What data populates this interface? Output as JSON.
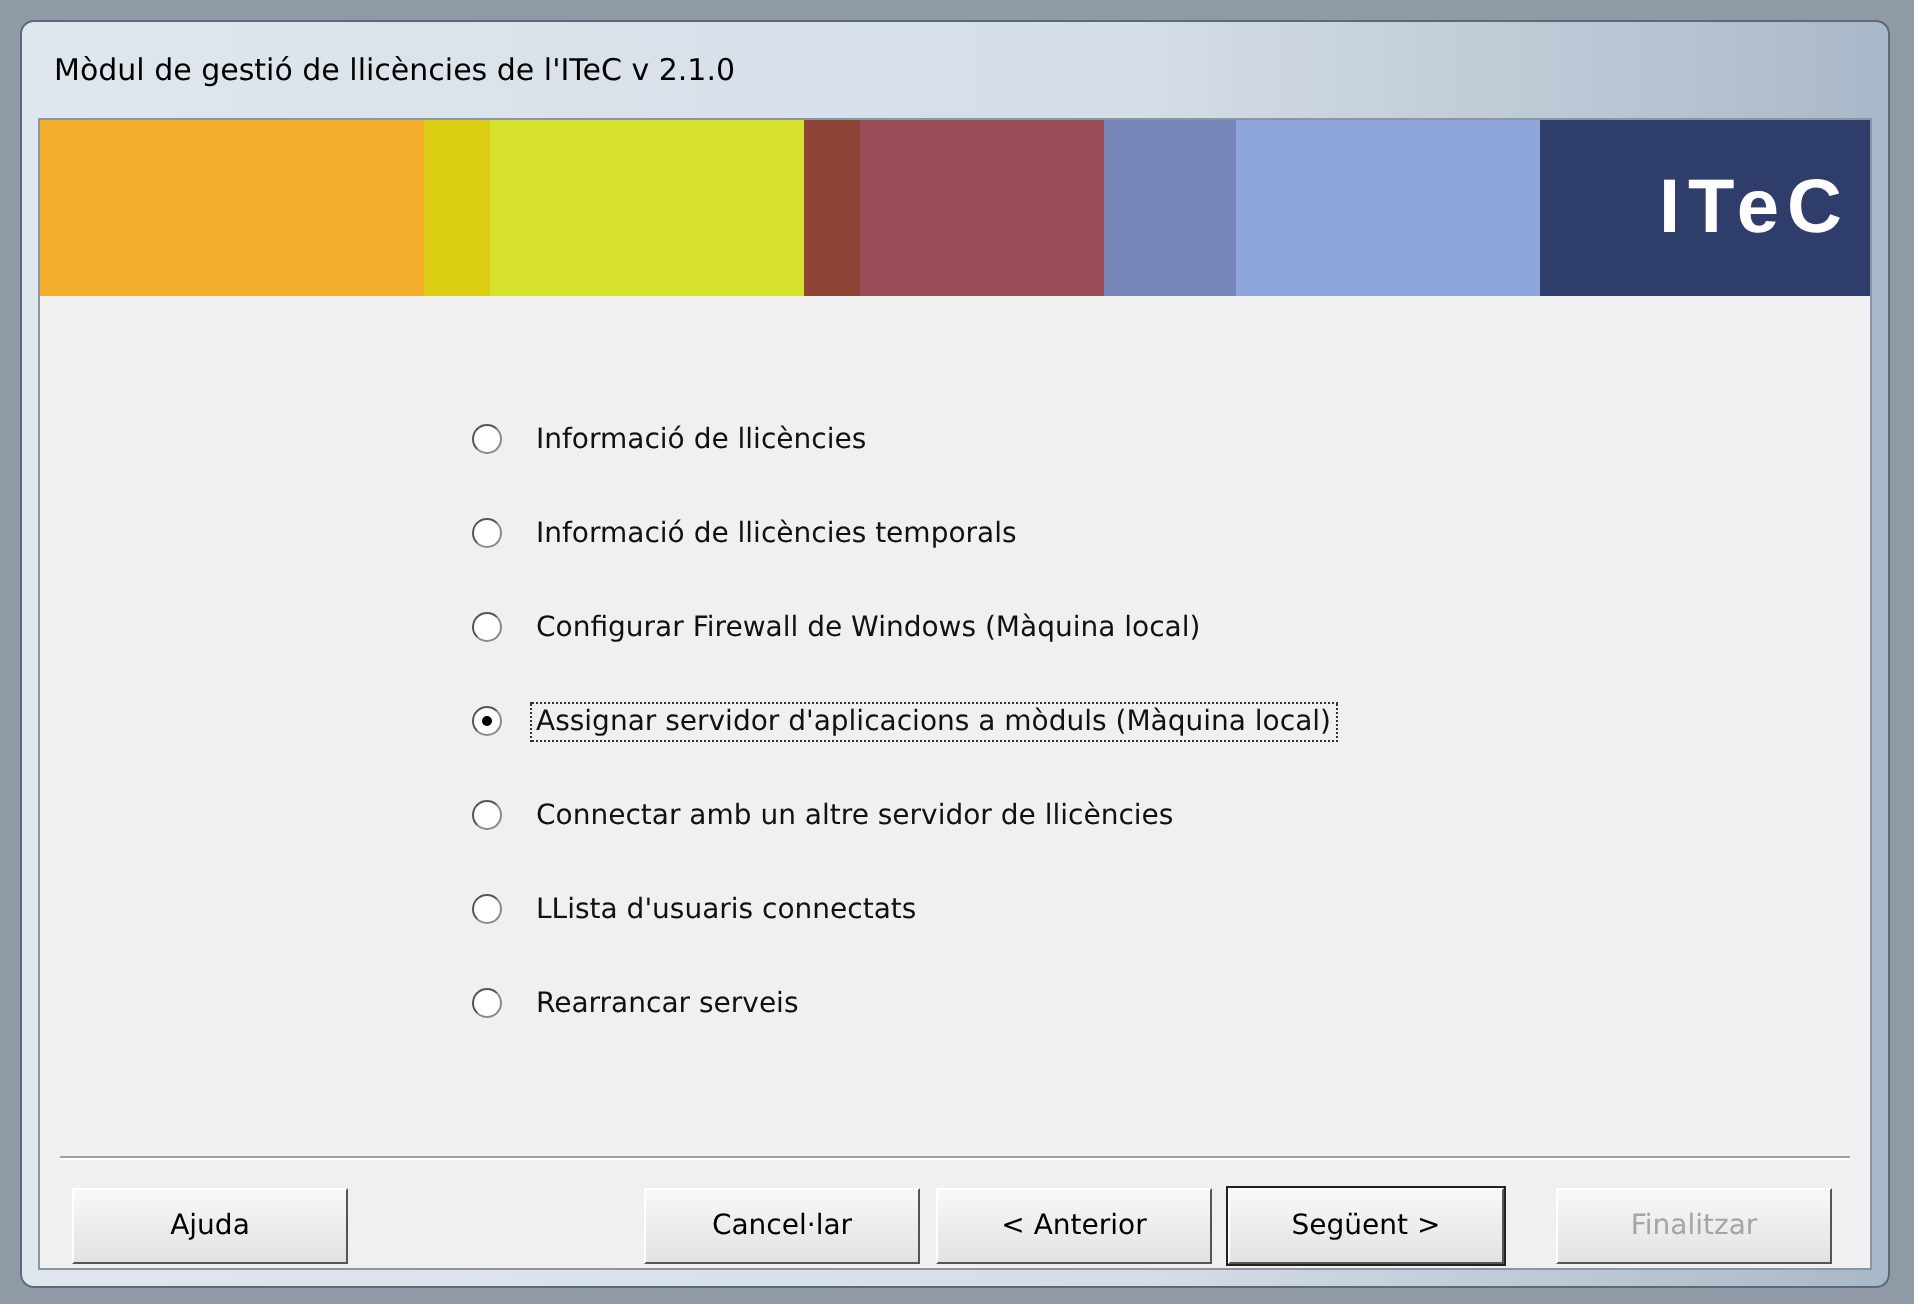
{
  "window": {
    "title": "Mòdul de gestió de llicències de l'ITeC v 2.1.0"
  },
  "banner": {
    "logo": "ITeC"
  },
  "options": [
    {
      "label": "Informació de llicències",
      "selected": false
    },
    {
      "label": "Informació de llicències temporals",
      "selected": false
    },
    {
      "label": "Configurar Firewall de Windows (Màquina local)",
      "selected": false
    },
    {
      "label": "Assignar servidor d'aplicacions a mòduls (Màquina local)",
      "selected": true
    },
    {
      "label": "Connectar amb un altre servidor de llicències",
      "selected": false
    },
    {
      "label": "LLista d'usuaris connectats",
      "selected": false
    },
    {
      "label": "Rearrancar serveis",
      "selected": false
    }
  ],
  "buttons": [
    {
      "label": "Ajuda",
      "kind": "help",
      "disabled": false,
      "default": false
    },
    {
      "label": "Cancel·lar",
      "kind": "nav",
      "disabled": false,
      "default": false
    },
    {
      "label": "< Anterior",
      "kind": "nav",
      "disabled": false,
      "default": false
    },
    {
      "label": "Següent >",
      "kind": "nav",
      "disabled": false,
      "default": true
    },
    {
      "label": "Finalitzar",
      "kind": "finish",
      "disabled": true,
      "default": false
    }
  ]
}
